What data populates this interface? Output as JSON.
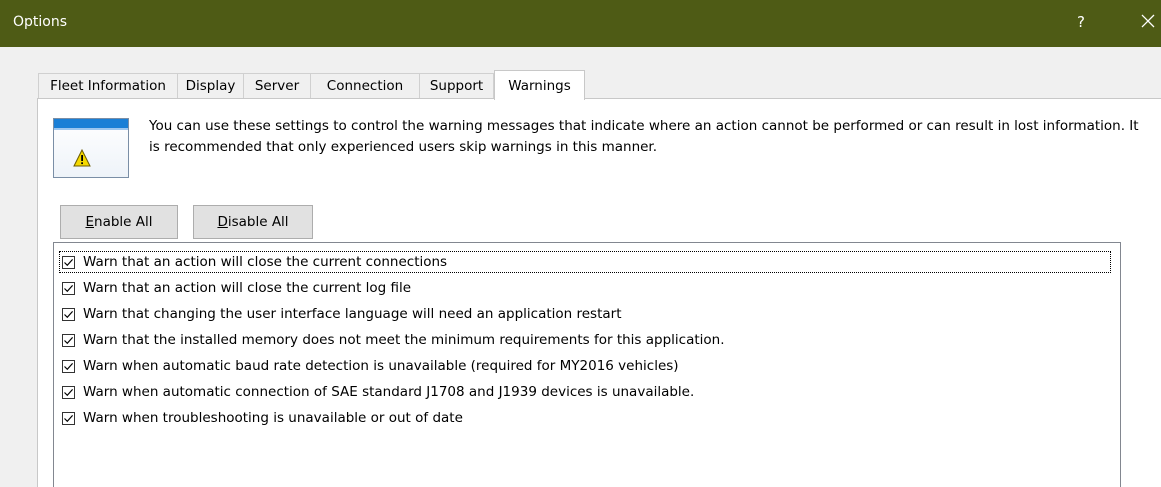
{
  "window": {
    "title": "Options",
    "help_label": "?"
  },
  "tabs": [
    {
      "label": "Fleet Information"
    },
    {
      "label": "Display"
    },
    {
      "label": "Server"
    },
    {
      "label": "Connection"
    },
    {
      "label": "Support"
    },
    {
      "label": "Warnings",
      "active": true
    }
  ],
  "info": {
    "text": "You can use these settings to control the warning messages that indicate where an action cannot be performed or can result in lost information. It is recommended that only experienced users skip warnings in this manner.",
    "icon": "warning-icon"
  },
  "buttons": {
    "enable_all": {
      "mnemonic": "E",
      "rest": "nable All"
    },
    "disable_all": {
      "mnemonic": "D",
      "rest": "isable All"
    }
  },
  "warnings": [
    {
      "label": "Warn that an action will close the current connections",
      "checked": true
    },
    {
      "label": "Warn that an action will close the current log file",
      "checked": true
    },
    {
      "label": "Warn that changing the user interface language will need an application restart",
      "checked": true
    },
    {
      "label": "Warn that the installed memory does not meet the minimum requirements for this application.",
      "checked": true
    },
    {
      "label": "Warn when automatic baud rate detection is unavailable (required for MY2016 vehicles)",
      "checked": true
    },
    {
      "label": "Warn when automatic connection of SAE standard J1708 and J1939 devices is unavailable.",
      "checked": true
    },
    {
      "label": "Warn when troubleshooting is unavailable or out of date",
      "checked": true
    }
  ],
  "colors": {
    "titlebar": "#4e5b15",
    "window_bg": "#f0f0f0",
    "accent_blue": "#1a7fd6",
    "warning_yellow": "#f5d900"
  }
}
